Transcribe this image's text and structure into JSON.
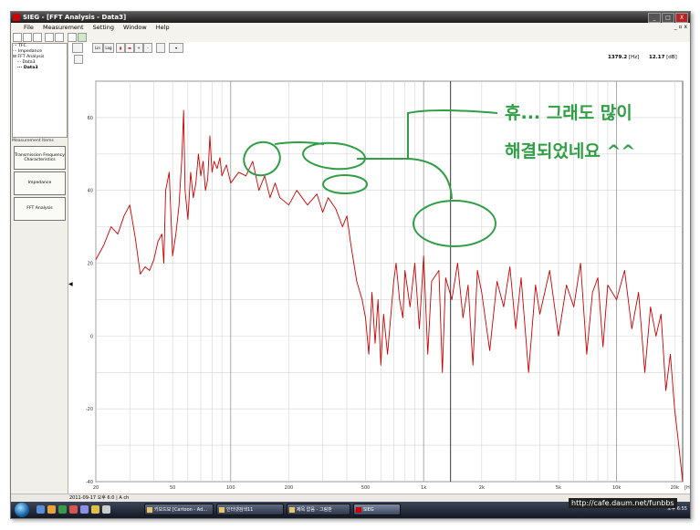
{
  "window": {
    "title": "SIEG - [FFT Analysis - Data3]",
    "min": "_",
    "max": "□",
    "close": "X"
  },
  "menu": [
    "File",
    "Measurement",
    "Setting",
    "Window",
    "Help"
  ],
  "mdi_controls": "_ ▫ x",
  "tree": [
    "TFC",
    "Impedance",
    "FFT Analysis",
    "Data3",
    "Data3"
  ],
  "measurement_items": {
    "title": "Measurement Items",
    "buttons": [
      "Transmission Frequency Characteristics",
      "Impedance",
      "FFT Analysis"
    ]
  },
  "toolbar": {
    "lin": "Lin",
    "log": "Log"
  },
  "readouts": {
    "freq": "1379.2",
    "freq_unit": "[Hz]",
    "level": "12.17",
    "level_unit": "[dB]"
  },
  "status": "2011-09-17 오후 6:0 | A ch",
  "annotation": {
    "line1": "휴... 그래도 많이",
    "line2": "해결되었네요 ^^",
    "color": "#2f9e44"
  },
  "colors": {
    "trace": "#cc0000",
    "title_bar": "#2a2a2a"
  },
  "taskbar": {
    "buttons": [
      "키보드보 [Cartoon - Ad...",
      "인터넷검색11",
      "제목 없음 - 그림판",
      "SIEG"
    ],
    "clock": "오후 6:55"
  },
  "watermark": "http://cafe.daum.net/funbbs",
  "chart_data": {
    "type": "line",
    "xscale": "log",
    "xlim": [
      20,
      22000
    ],
    "ylim": [
      -40,
      70
    ],
    "x_ticks": [
      20,
      50,
      100,
      200,
      500,
      1000,
      2000,
      5000,
      10000,
      20000
    ],
    "x_tick_labels": [
      "20",
      "50",
      "100",
      "200",
      "500",
      "1k",
      "2k",
      "5k",
      "10k",
      "20k"
    ],
    "x_unit": "[Hz]",
    "y_ticks": [
      60,
      40,
      20,
      0,
      -20,
      -40
    ],
    "y_tick_labels": [
      "60",
      "40",
      "20",
      "0",
      "-20",
      "-40"
    ],
    "grid": true,
    "cursor_x": 1379.2,
    "series": [
      {
        "color": "#cc0000",
        "points": [
          [
            20,
            21
          ],
          [
            22,
            25
          ],
          [
            24,
            30
          ],
          [
            26,
            28
          ],
          [
            28,
            33
          ],
          [
            30,
            36
          ],
          [
            32,
            27
          ],
          [
            34,
            17
          ],
          [
            36,
            19
          ],
          [
            38,
            18
          ],
          [
            40,
            21
          ],
          [
            42,
            26
          ],
          [
            44,
            28
          ],
          [
            45,
            20
          ],
          [
            46,
            40
          ],
          [
            48,
            45
          ],
          [
            50,
            22
          ],
          [
            52,
            28
          ],
          [
            54,
            36
          ],
          [
            56,
            50
          ],
          [
            57,
            62
          ],
          [
            58,
            40
          ],
          [
            60,
            32
          ],
          [
            62,
            45
          ],
          [
            64,
            38
          ],
          [
            66,
            42
          ],
          [
            68,
            50
          ],
          [
            70,
            44
          ],
          [
            72,
            48
          ],
          [
            74,
            40
          ],
          [
            76,
            43
          ],
          [
            78,
            55
          ],
          [
            80,
            45
          ],
          [
            82,
            48
          ],
          [
            85,
            46
          ],
          [
            88,
            49
          ],
          [
            90,
            44
          ],
          [
            95,
            47
          ],
          [
            100,
            42
          ],
          [
            110,
            45
          ],
          [
            120,
            44
          ],
          [
            130,
            48
          ],
          [
            140,
            40
          ],
          [
            150,
            44
          ],
          [
            160,
            38
          ],
          [
            170,
            42
          ],
          [
            180,
            38
          ],
          [
            200,
            36
          ],
          [
            220,
            40
          ],
          [
            250,
            36
          ],
          [
            280,
            39
          ],
          [
            300,
            34
          ],
          [
            320,
            38
          ],
          [
            350,
            35
          ],
          [
            380,
            30
          ],
          [
            400,
            33
          ],
          [
            420,
            25
          ],
          [
            450,
            15
          ],
          [
            480,
            10
          ],
          [
            500,
            5
          ],
          [
            520,
            -5
          ],
          [
            540,
            12
          ],
          [
            560,
            -2
          ],
          [
            580,
            10
          ],
          [
            600,
            -8
          ],
          [
            620,
            6
          ],
          [
            650,
            -5
          ],
          [
            700,
            15
          ],
          [
            720,
            20
          ],
          [
            750,
            10
          ],
          [
            780,
            5
          ],
          [
            800,
            18
          ],
          [
            850,
            8
          ],
          [
            900,
            20
          ],
          [
            950,
            2
          ],
          [
            1000,
            22
          ],
          [
            1050,
            -5
          ],
          [
            1100,
            15
          ],
          [
            1200,
            18
          ],
          [
            1250,
            -10
          ],
          [
            1300,
            16
          ],
          [
            1400,
            10
          ],
          [
            1500,
            20
          ],
          [
            1600,
            5
          ],
          [
            1700,
            14
          ],
          [
            1800,
            -8
          ],
          [
            1900,
            18
          ],
          [
            2000,
            12
          ],
          [
            2200,
            -4
          ],
          [
            2400,
            15
          ],
          [
            2600,
            8
          ],
          [
            2800,
            19
          ],
          [
            3000,
            2
          ],
          [
            3200,
            16
          ],
          [
            3500,
            -10
          ],
          [
            3800,
            14
          ],
          [
            4000,
            6
          ],
          [
            4500,
            18
          ],
          [
            5000,
            0
          ],
          [
            5500,
            14
          ],
          [
            6000,
            8
          ],
          [
            6500,
            20
          ],
          [
            7000,
            -5
          ],
          [
            7500,
            12
          ],
          [
            8000,
            16
          ],
          [
            8500,
            -3
          ],
          [
            9000,
            14
          ],
          [
            10000,
            10
          ],
          [
            11000,
            18
          ],
          [
            12000,
            2
          ],
          [
            13000,
            12
          ],
          [
            14000,
            -10
          ],
          [
            15000,
            8
          ],
          [
            16000,
            0
          ],
          [
            17000,
            6
          ],
          [
            18000,
            -15
          ],
          [
            19000,
            -5
          ],
          [
            20000,
            -20
          ],
          [
            21000,
            -30
          ],
          [
            22000,
            -40
          ]
        ]
      }
    ]
  }
}
